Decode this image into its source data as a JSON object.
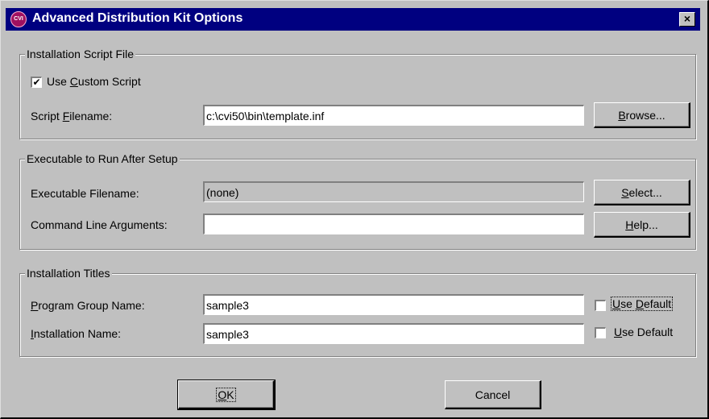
{
  "window": {
    "title": "Advanced Distribution Kit Options",
    "icon_text": "CVI",
    "close_label": "×"
  },
  "groups": {
    "script": {
      "legend": "Installation Script File",
      "use_custom_checked": true,
      "use_custom_label_pre": "Use ",
      "use_custom_label_u": "C",
      "use_custom_label_post": "ustom Script",
      "filename_label_pre": "Script ",
      "filename_label_u": "F",
      "filename_label_post": "ilename:",
      "filename_value": "c:\\cvi50\\bin\\template.inf",
      "browse_u": "B",
      "browse_post": "rowse..."
    },
    "executable": {
      "legend": "Executable to Run After Setup",
      "exe_label": "Executable Filename:",
      "exe_value": "(none)",
      "select_u": "S",
      "select_post": "elect...",
      "args_label": "Command Line Arguments:",
      "args_value": "",
      "help_u": "H",
      "help_post": "elp..."
    },
    "titles": {
      "legend": "Installation Titles",
      "group_label_u": "P",
      "group_label_post": "rogram Group Name:",
      "group_value": "sample3",
      "group_default_checked": false,
      "group_default_u": "U",
      "group_default_mid": "se ",
      "group_default_u2": "D",
      "group_default_post": "efault",
      "inst_label_u": "I",
      "inst_label_post": "nstallation Name:",
      "inst_value": "sample3",
      "inst_default_checked": false,
      "inst_default_u": "U",
      "inst_default_post": "se Default"
    }
  },
  "footer": {
    "ok_u": "O",
    "ok_post": "K",
    "cancel": "Cancel"
  }
}
